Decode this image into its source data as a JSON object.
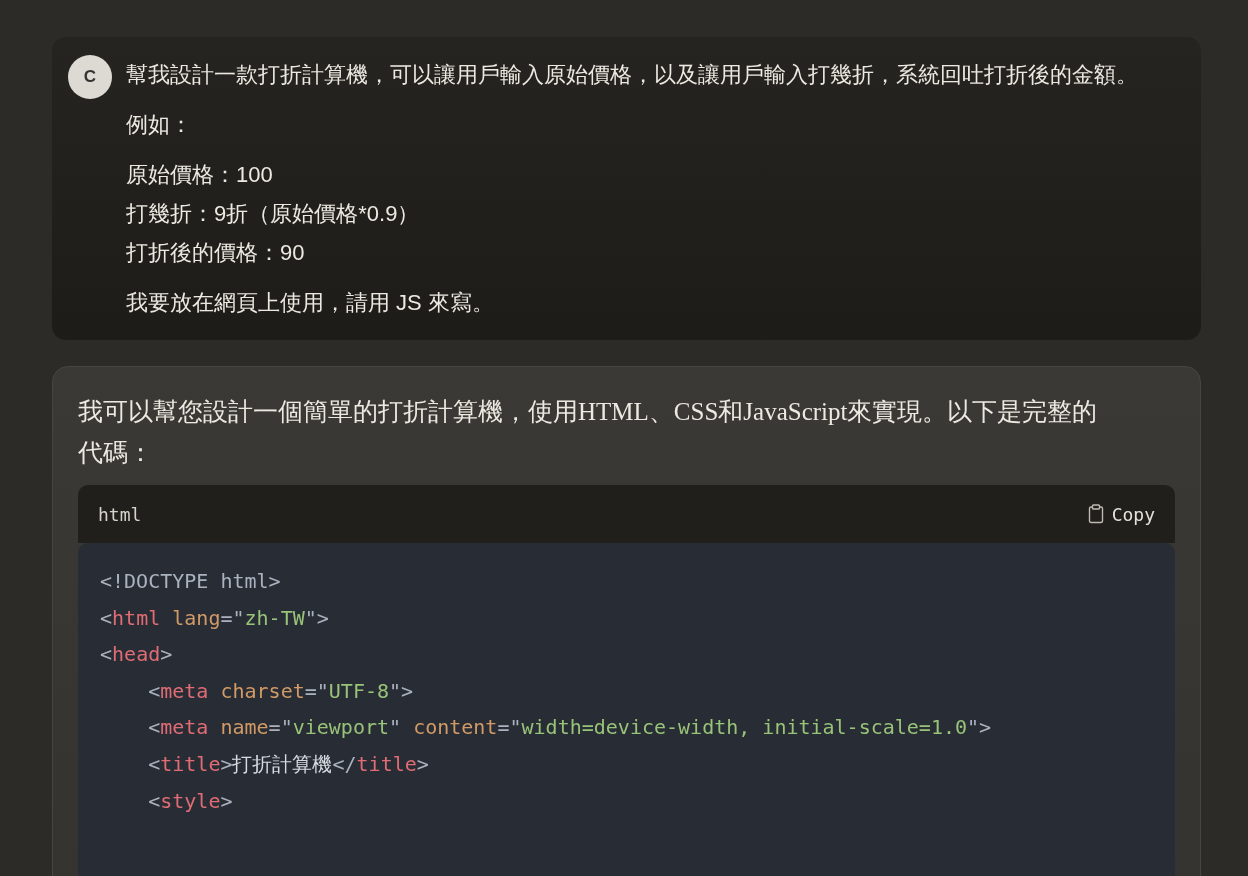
{
  "user_message": {
    "avatar_initial": "C",
    "paragraphs": [
      [
        "幫我設計一款打折計算機，可以讓用戶輸入原始價格，以及讓用戶輸入打幾折，系統回吐打折後的金額。"
      ],
      [
        "例如："
      ],
      [
        "原始價格：100",
        "打幾折：9折（原始價格*0.9）",
        "打折後的價格：90"
      ],
      [
        "我要放在網頁上使用，請用 JS 來寫。"
      ]
    ]
  },
  "assistant_message": {
    "intro": "我可以幫您設計一個簡單的打折計算機，使用HTML、CSS和JavaScript來實現。以下是完整的代碼：",
    "code_block": {
      "language": "html",
      "copy_label": "Copy",
      "lines": [
        [
          {
            "kind": "punct",
            "text": "<!DOCTYPE html>"
          }
        ],
        [
          {
            "kind": "punct",
            "text": "<"
          },
          {
            "kind": "tag",
            "text": "html"
          },
          {
            "kind": "attr",
            "text": " lang"
          },
          {
            "kind": "punct",
            "text": "=\""
          },
          {
            "kind": "str",
            "text": "zh-TW"
          },
          {
            "kind": "punct",
            "text": "\">"
          }
        ],
        [
          {
            "kind": "punct",
            "text": "<"
          },
          {
            "kind": "tag",
            "text": "head"
          },
          {
            "kind": "punct",
            "text": ">"
          }
        ],
        [
          {
            "kind": "punct",
            "text": "    <"
          },
          {
            "kind": "tag",
            "text": "meta"
          },
          {
            "kind": "attr",
            "text": " charset"
          },
          {
            "kind": "punct",
            "text": "=\""
          },
          {
            "kind": "str",
            "text": "UTF-8"
          },
          {
            "kind": "punct",
            "text": "\">"
          }
        ],
        [
          {
            "kind": "punct",
            "text": "    <"
          },
          {
            "kind": "tag",
            "text": "meta"
          },
          {
            "kind": "attr",
            "text": " name"
          },
          {
            "kind": "punct",
            "text": "=\""
          },
          {
            "kind": "str",
            "text": "viewport"
          },
          {
            "kind": "punct",
            "text": "\" "
          },
          {
            "kind": "attr",
            "text": "content"
          },
          {
            "kind": "punct",
            "text": "=\""
          },
          {
            "kind": "str",
            "text": "width=device-width, initial-scale=1.0"
          },
          {
            "kind": "punct",
            "text": "\">"
          }
        ],
        [
          {
            "kind": "punct",
            "text": "    <"
          },
          {
            "kind": "tag",
            "text": "title"
          },
          {
            "kind": "punct",
            "text": ">"
          },
          {
            "kind": "text",
            "text": "打折計算機"
          },
          {
            "kind": "punct",
            "text": "</"
          },
          {
            "kind": "tag",
            "text": "title"
          },
          {
            "kind": "punct",
            "text": ">"
          }
        ],
        [
          {
            "kind": "punct",
            "text": "    <"
          },
          {
            "kind": "tag",
            "text": "style"
          },
          {
            "kind": "punct",
            "text": ">"
          }
        ]
      ]
    }
  }
}
